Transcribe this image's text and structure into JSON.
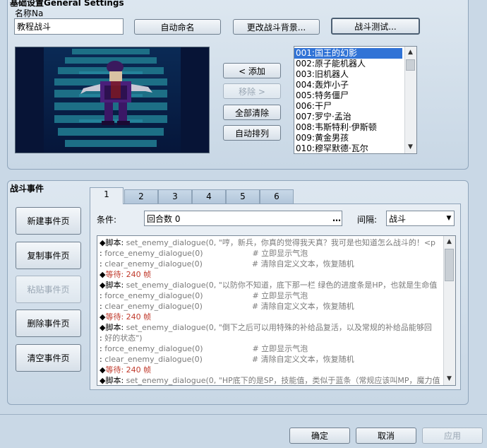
{
  "general": {
    "title": "基础设置General Settings",
    "name_label": "名称Na",
    "name_value": "教程战斗",
    "auto_name": "自动命名",
    "change_bg": "更改战斗背景...",
    "battle_test": "战斗测试..."
  },
  "buttons": {
    "add": "< 添加",
    "remove": "移除 >",
    "clear_all": "全部清除",
    "auto_arrange": "自动排列"
  },
  "enemies": [
    "001:国王的幻影",
    "002:原子能机器人",
    "003:旧机器人",
    "004:轰炸小子",
    "005:特务僵尸",
    "006:干尸",
    "007:罗宁·孟治",
    "008:韦斯特利·伊斯顿",
    "009:黄金男孩",
    "010:穆罕默德·瓦尔"
  ],
  "events": {
    "section_title": "战斗事件",
    "tabs": [
      "1",
      "2",
      "3",
      "4",
      "5",
      "6"
    ],
    "condition_label": "条件:",
    "condition_value": "回合数 0",
    "span_label": "间隔:",
    "span_value": "战斗",
    "page_buttons": {
      "new": "新建事件页",
      "copy": "复制事件页",
      "paste": "粘贴事件页",
      "delete": "删除事件页",
      "clear": "清空事件页"
    },
    "lines": [
      {
        "prefix": "◆脚本:",
        "text": " set_enemy_dialogue(0, \"哼，新兵，你真的觉得我天真？我可是也知道怎么战斗的！<p",
        "style": "gray"
      },
      {
        "prefix": "  :",
        "text": " force_enemy_dialogue(0)                    # 立即显示气泡",
        "style": "gray"
      },
      {
        "prefix": "  :",
        "text": " clear_enemy_dialogue(0)                    # 清除自定义文本，恢复随机",
        "style": "gray"
      },
      {
        "prefix": "◆",
        "text": "等待: 240 帧",
        "style": "wait"
      },
      {
        "prefix": "◆脚本:",
        "text": " set_enemy_dialogue(0, \"以防你不知道，底下那一栏 绿色的进度条是HP，也就是生命值",
        "style": "gray"
      },
      {
        "prefix": "  :",
        "text": " force_enemy_dialogue(0)                    # 立即显示气泡",
        "style": "gray"
      },
      {
        "prefix": "  :",
        "text": " clear_enemy_dialogue(0)                    # 清除自定义文本，恢复随机",
        "style": "gray"
      },
      {
        "prefix": "◆",
        "text": "等待: 240 帧",
        "style": "wait"
      },
      {
        "prefix": "◆脚本:",
        "text": " set_enemy_dialogue(0, \"倒下之后可以用特殊的补给品复活，以及常规的补给品能够回",
        "style": "gray"
      },
      {
        "prefix": "  :",
        "text": " 好的状态\")",
        "style": "gray"
      },
      {
        "prefix": "  :",
        "text": " force_enemy_dialogue(0)                    # 立即显示气泡",
        "style": "gray"
      },
      {
        "prefix": "  :",
        "text": " clear_enemy_dialogue(0)                    # 清除自定义文本，恢复随机",
        "style": "gray"
      },
      {
        "prefix": "◆",
        "text": "等待: 240 帧",
        "style": "wait"
      },
      {
        "prefix": "◆脚本:",
        "text": " set_enemy_dialogue(0, \"HP底下的是SP，技能值，类似于蓝条（常规应该叫MP，魔力值",
        "style": "gray"
      }
    ]
  },
  "footer": {
    "ok": "确定",
    "cancel": "取消",
    "apply": "应用"
  }
}
